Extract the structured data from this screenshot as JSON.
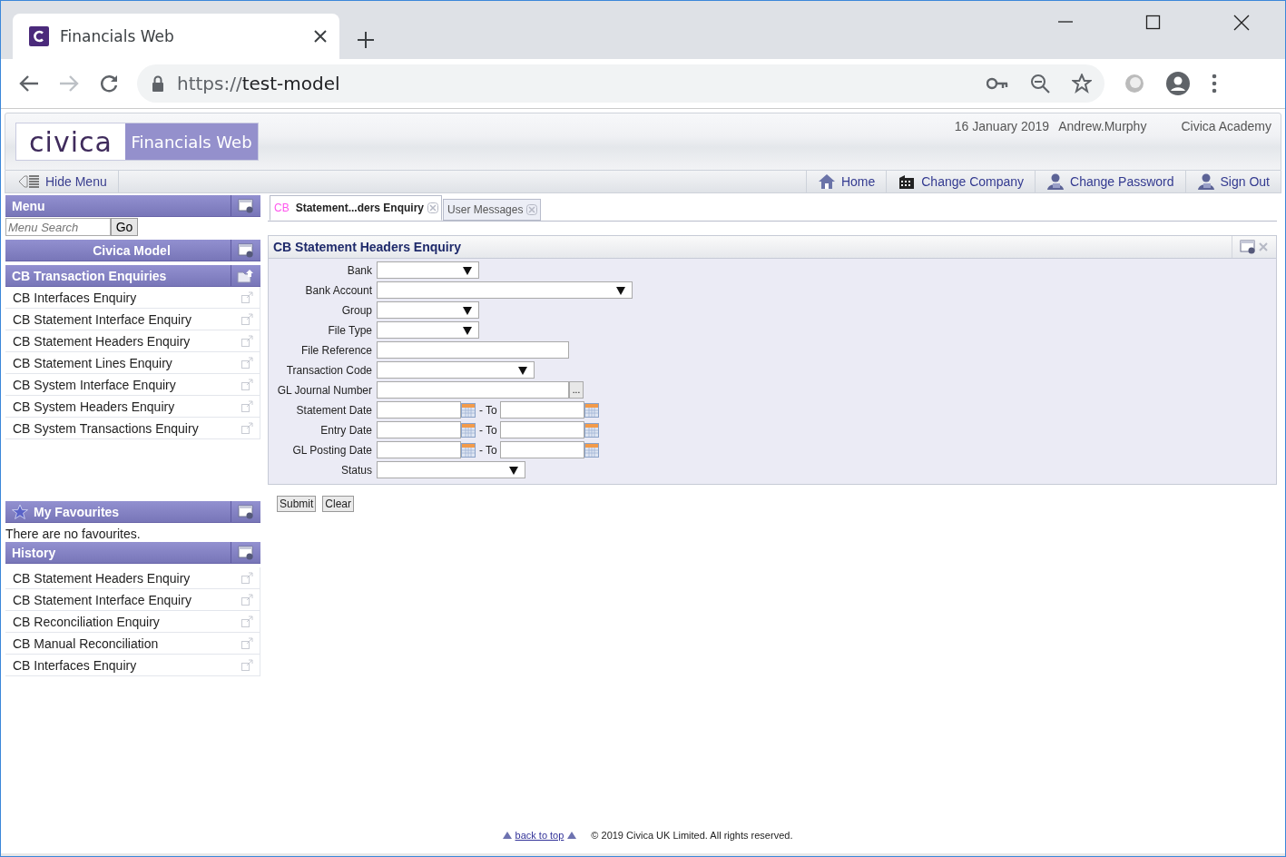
{
  "browser": {
    "tab_title": "Financials Web",
    "url_scheme": "https://",
    "url_host": "test-model"
  },
  "header": {
    "logo": "civica",
    "product": "Financials Web",
    "date": "16 January 2019",
    "user": "Andrew.Murphy",
    "organisation": "Civica Academy"
  },
  "toolbar": {
    "hide_menu": "Hide Menu",
    "links": [
      {
        "label": "Home",
        "kind": "home"
      },
      {
        "label": "Change Company",
        "kind": "company"
      },
      {
        "label": "Change Password",
        "kind": "person"
      },
      {
        "label": "Sign Out",
        "kind": "person"
      }
    ]
  },
  "sidebar": {
    "menu_title": "Menu",
    "search_placeholder": "Menu Search",
    "go": "Go",
    "model_title": "Civica Model",
    "group_title": "CB Transaction Enquiries",
    "items": [
      "CB Interfaces Enquiry",
      "CB Statement Interface Enquiry",
      "CB Statement Headers Enquiry",
      "CB Statement Lines Enquiry",
      "CB System Interface Enquiry",
      "CB System Headers Enquiry",
      "CB System Transactions Enquiry"
    ],
    "favourites_title": "My Favourites",
    "favourites_empty": "There are no favourites.",
    "history_title": "History",
    "history": [
      "CB Statement Headers Enquiry",
      "CB Statement Interface Enquiry",
      "CB Reconciliation Enquiry",
      "CB Manual Reconciliation",
      "CB Interfaces Enquiry"
    ]
  },
  "tabs": [
    {
      "prefix": "CB",
      "label": "Statement...ders Enquiry",
      "selected": true
    },
    {
      "label": "User Messages",
      "selected": false
    }
  ],
  "form": {
    "title": "CB Statement Headers Enquiry",
    "fields": [
      {
        "label": "Bank",
        "kind": "select"
      },
      {
        "label": "Bank Account",
        "kind": "select"
      },
      {
        "label": "Group",
        "kind": "select"
      },
      {
        "label": "File Type",
        "kind": "select"
      },
      {
        "label": "File Reference",
        "kind": "text"
      },
      {
        "label": "Transaction Code",
        "kind": "select"
      },
      {
        "label": "GL Journal Number",
        "kind": "lookup",
        "button": "..."
      },
      {
        "label": "Statement Date",
        "kind": "date-range",
        "separator": "- To"
      },
      {
        "label": "Entry Date",
        "kind": "date-range",
        "separator": "- To"
      },
      {
        "label": "GL Posting Date",
        "kind": "date-range",
        "separator": "- To"
      },
      {
        "label": "Status",
        "kind": "select"
      }
    ],
    "buttons": [
      "Submit",
      "Clear"
    ]
  },
  "footer": {
    "back_to_top": "back to top",
    "copyright": "© 2019 Civica UK Limited. All rights reserved."
  }
}
